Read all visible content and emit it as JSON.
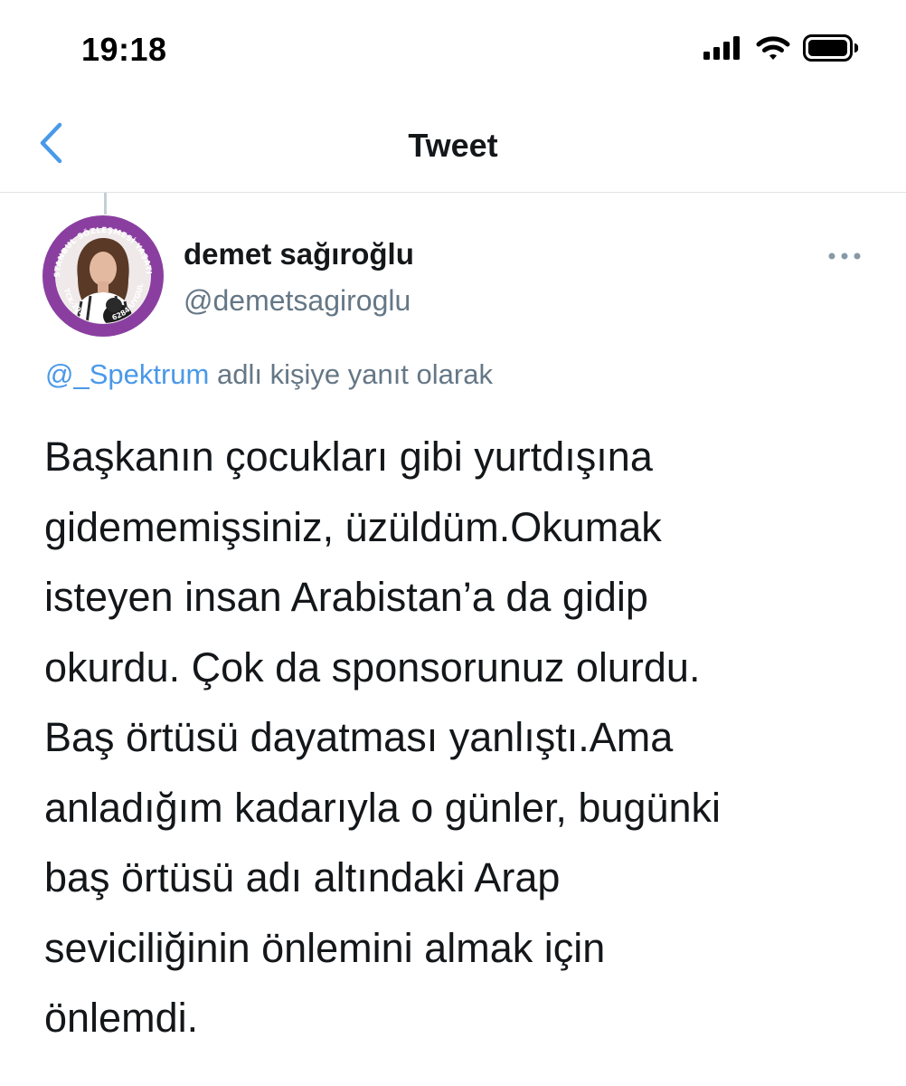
{
  "status_bar": {
    "time": "19:18",
    "signal_icon": "cellular-signal-icon",
    "wifi_icon": "wifi-icon",
    "battery_icon": "battery-icon"
  },
  "nav": {
    "back_icon": "chevron-left-icon",
    "title": "Tweet"
  },
  "tweet": {
    "author": {
      "name": "demet sağıroğlu",
      "handle": "@demetsagiroglu",
      "avatar_badge_text": "İSTANBUL SÖZLEŞMESİ YAŞATIR · TCK 103 · 6284 UYGULA"
    },
    "more_icon": "more-horizontal-icon",
    "reply_context": {
      "mention": "@_Spektrum",
      "suffix": " adlı kişiye yanıt olarak"
    },
    "text_lines": [
      "Başkanın çocukları gibi yurtdışına",
      "gidememişsiniz, üzüldüm.Okumak",
      "isteyen insan Arabistan’a da gidip",
      "okurdu. Çok da sponsorunuz olurdu.",
      "Baş örtüsü dayatması yanlıştı.Ama",
      "anladığım kadarıyla o günler, bugünki",
      "baş örtüsü adı altındaki Arap",
      "seviciliğinin önlemini almak için",
      "önlemdi."
    ]
  },
  "colors": {
    "link_blue": "#4a99e9",
    "secondary_text": "#657786",
    "primary_text": "#14171a",
    "badge_purple": "#8a3fa0",
    "divider": "#dfe3e6"
  }
}
